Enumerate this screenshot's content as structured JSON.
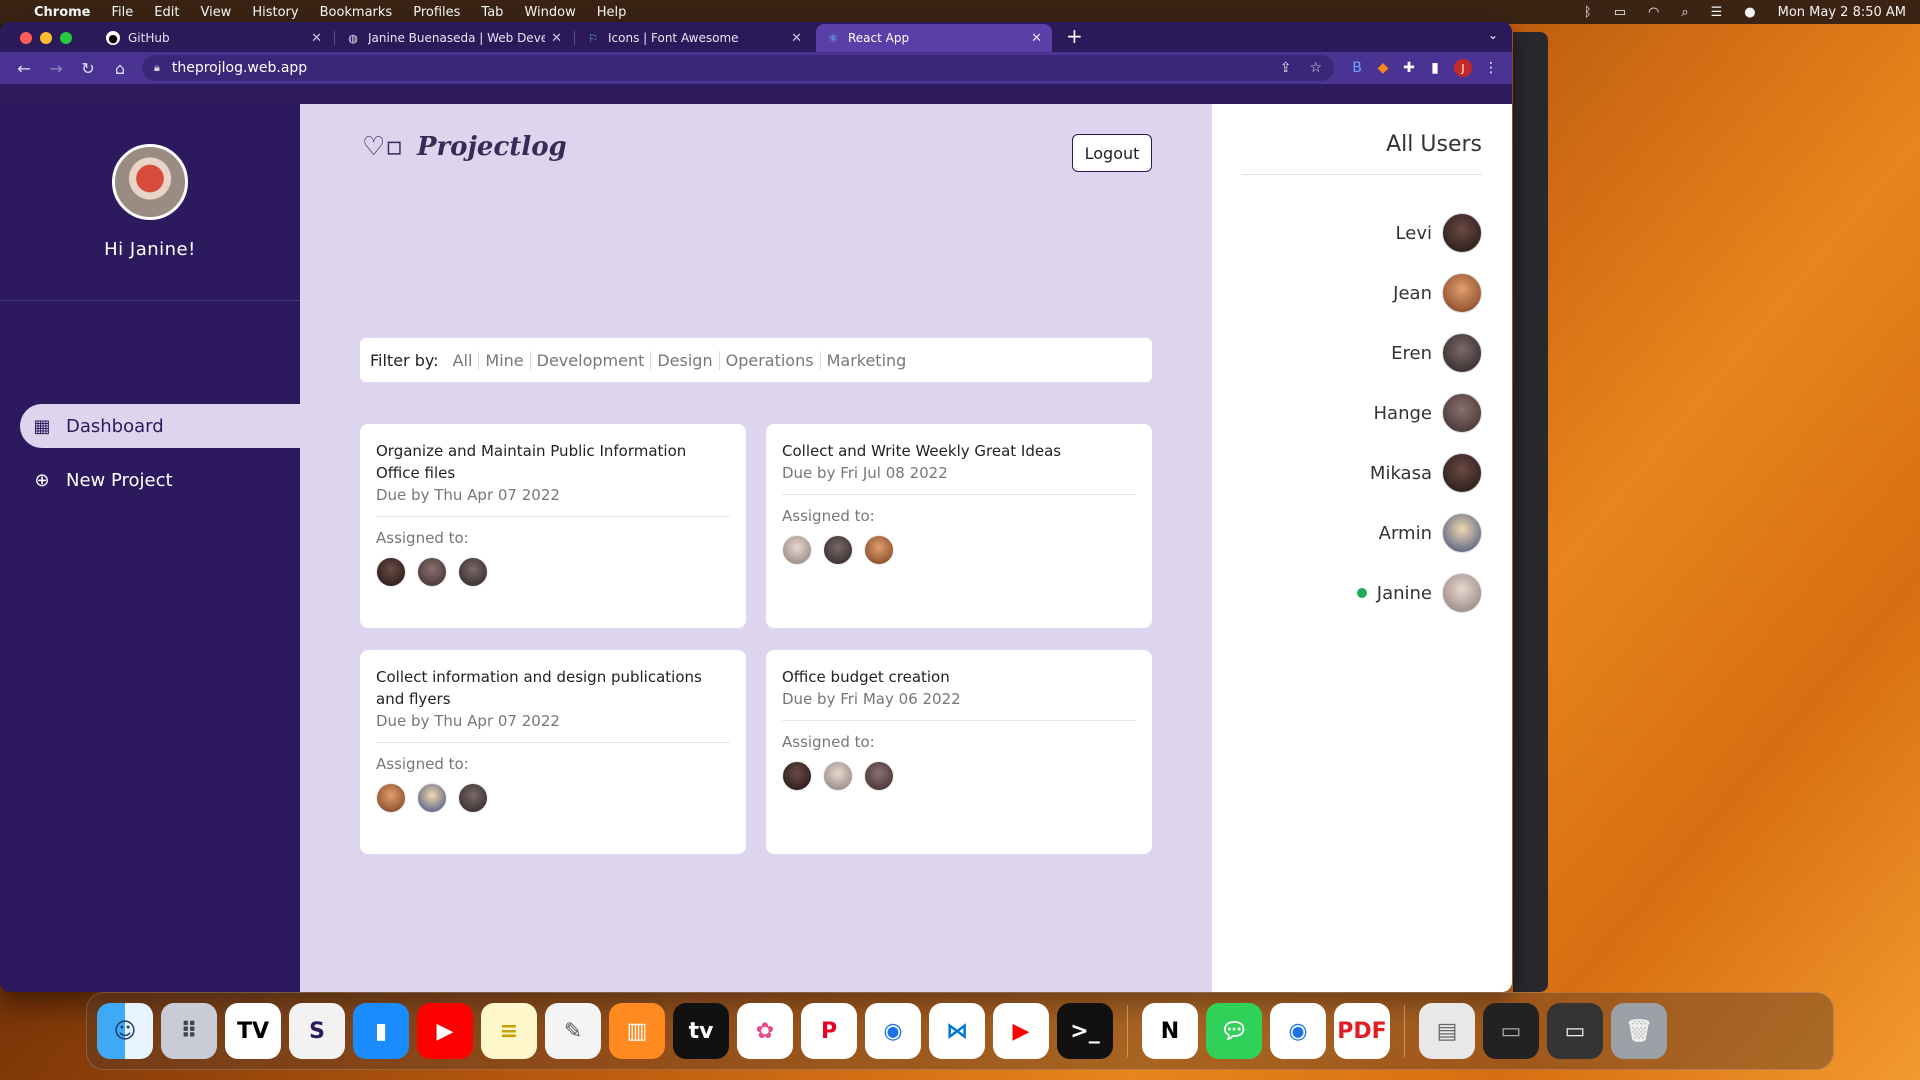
{
  "menubar": {
    "app": "Chrome",
    "items": [
      "File",
      "Edit",
      "View",
      "History",
      "Bookmarks",
      "Profiles",
      "Tab",
      "Window",
      "Help"
    ],
    "datetime": "Mon May 2  8:50 AM"
  },
  "tabs": [
    {
      "title": "GitHub",
      "icon": "github-icon"
    },
    {
      "title": "Janine Buenaseda | Web Devel",
      "icon": "globe-icon"
    },
    {
      "title": "Icons | Font Awesome",
      "icon": "flag-icon"
    },
    {
      "title": "React App",
      "icon": "react-icon"
    }
  ],
  "address": "theprojlog.web.app",
  "sidebar": {
    "greeting": "Hi Janine!",
    "nav": [
      {
        "label": "Dashboard",
        "icon": "dashboard-icon"
      },
      {
        "label": "New Project",
        "icon": "plus-circle-icon"
      }
    ]
  },
  "header": {
    "logo": "Projectlog",
    "logout": "Logout"
  },
  "filter": {
    "label": "Filter by:",
    "options": [
      "All",
      "Mine",
      "Development",
      "Design",
      "Operations",
      "Marketing"
    ]
  },
  "projects": [
    {
      "title": "Organize and Maintain Public Information Office files",
      "due": "Due by Thu Apr 07 2022",
      "assigned_label": "Assigned to:"
    },
    {
      "title": "Collect and Write Weekly Great Ideas",
      "due": "Due by Fri Jul 08 2022",
      "assigned_label": "Assigned to:"
    },
    {
      "title": "Collect information and design publications and flyers",
      "due": "Due by Thu Apr 07 2022",
      "assigned_label": "Assigned to:"
    },
    {
      "title": "Office budget creation",
      "due": "Due by Fri May 06 2022",
      "assigned_label": "Assigned to:"
    }
  ],
  "users_panel": {
    "title": "All Users",
    "users": [
      "Levi",
      "Jean",
      "Eren",
      "Hange",
      "Mikasa",
      "Armin",
      "Janine"
    ],
    "online_user": "Janine"
  },
  "colors": {
    "sidebar": "#2d1a5e",
    "main_bg": "#ddd4ee",
    "online": "#1faa59"
  }
}
